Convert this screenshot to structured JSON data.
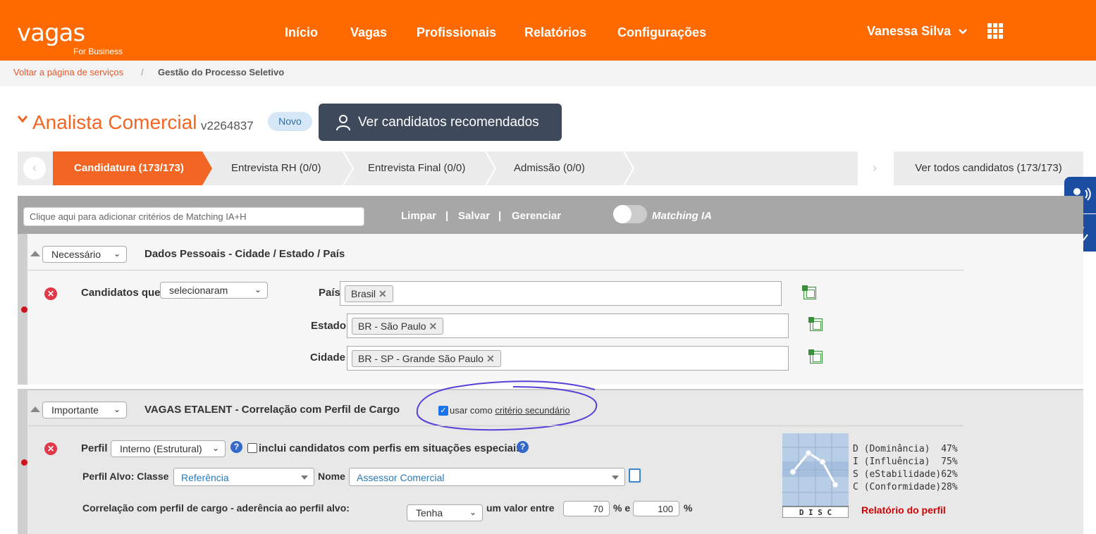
{
  "header": {
    "logo_main": "vagas",
    "logo_sub": "For Business",
    "nav": [
      "Início",
      "Vagas",
      "Profissionais",
      "Relatórios",
      "Configurações"
    ],
    "user_name": "Vanessa Silva",
    "user_caret": "⌄",
    "apps_icon": "grid-icon"
  },
  "breadcrumb": {
    "back_link": "Voltar a página de serviços",
    "separator": "/",
    "current": "Gestão do Processo Seletivo"
  },
  "job": {
    "title": "Analista Comercial",
    "code": "v2264837",
    "badge": "Novo",
    "recommend_button": "Ver candidatos recomendados"
  },
  "stages": {
    "items": [
      "Candidatura (173/173)",
      "Entrevista RH (0/0)",
      "Entrevista Final (0/0)",
      "Admissão (0/0)"
    ],
    "active_index": 0,
    "active_color": "#f26522",
    "all_label": "Ver todos candidatos (173/173)"
  },
  "criteria_bar": {
    "input_placeholder": "Clique aqui para adicionar critérios de Matching IA+H",
    "clear": "Limpar",
    "save": "Salvar",
    "manage": "Gerenciar",
    "sep": "|",
    "matching_label": "Matching IA",
    "matching_on": false
  },
  "section1": {
    "priority": "Necessário",
    "title": "Dados Pessoais - Cidade / Estado / País",
    "candidates_label": "Candidatos que",
    "candidates_select": "selecionaram",
    "country_label": "País",
    "country_tag": "Brasil",
    "state_label": "Estado",
    "state_tag": "BR - São Paulo",
    "city_label": "Cidade",
    "city_tag": "BR - SP - Grande São Paulo"
  },
  "section2": {
    "priority": "Importante",
    "title": "VAGAS ETALENT - Correlação com Perfil de Cargo",
    "secondary_prefix": "usar como",
    "secondary_link": "critério secundário",
    "secondary_checked": true,
    "profile_label": "Perfil",
    "profile_select": "Interno (Estrutural)",
    "special_label": "inclui candidatos com perfis em situações especiais",
    "target_label": "Perfil Alvo: Classe",
    "target_class": "Referência",
    "name_label": "Nome",
    "target_name": "Assessor Comercial",
    "correlation_label": "Correlação com perfil de cargo - aderência ao perfil alvo:",
    "correlation_select": "Tenha",
    "range_label": "um valor entre",
    "range_min": "70",
    "range_mid": "% e",
    "range_max": "100",
    "range_end": "%"
  },
  "disc": {
    "chart_label": "D I S C",
    "lines": [
      "D (Dominância)  47%",
      "I (Influência)  75%",
      "S (eStabilidade)62%",
      "C (Conformidade)28%"
    ],
    "values": [
      47,
      75,
      62,
      28
    ],
    "report_link": "Relatório do perfil"
  },
  "colors": {
    "brand": "#ff6a00",
    "accent": "#f26522",
    "annotation": "#5b3fd8"
  }
}
